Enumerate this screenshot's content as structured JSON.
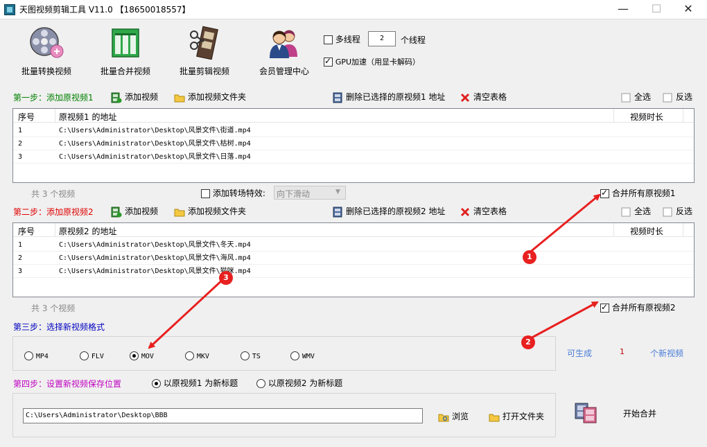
{
  "window": {
    "title": "天图视频剪辑工具 V11.0  【18650018557】",
    "minimize_glyph": "—",
    "maximize_glyph": "☐",
    "close_glyph": "✕"
  },
  "toolbar": {
    "buttons": [
      {
        "label": "批量转换视频",
        "icon": "film-reel-icon"
      },
      {
        "label": "批量合并视频",
        "icon": "merge-grid-icon"
      },
      {
        "label": "批量剪辑视频",
        "icon": "film-scissors-icon"
      },
      {
        "label": "会员管理中心",
        "icon": "members-icon"
      }
    ],
    "multithread_label": "多线程",
    "thread_count": "2",
    "thread_unit": "个线程",
    "gpu_label": "GPU加速（用显卡解码）"
  },
  "step1": {
    "title": "第一步：添加原视频1",
    "add_video": "添加视频",
    "add_folder": "添加视频文件夹",
    "delete_selected": "删除已选择的原视频1 地址",
    "clear_table": "清空表格",
    "select_all": "全选",
    "invert": "反选",
    "columns": {
      "index": "序号",
      "path": "原视频1 的地址",
      "duration": "视频时长"
    },
    "rows": [
      {
        "index": "1",
        "path": "C:\\Users\\Administrator\\Desktop\\风景文件\\街道.mp4"
      },
      {
        "index": "2",
        "path": "C:\\Users\\Administrator\\Desktop\\风景文件\\枯树.mp4"
      },
      {
        "index": "3",
        "path": "C:\\Users\\Administrator\\Desktop\\风景文件\\日落.mp4"
      }
    ],
    "count_text": "共 3 个视频",
    "transition_label": "添加转场特效:",
    "transition_value": "向下滑动",
    "merge_label": "合并所有原视频1"
  },
  "step2": {
    "title": "第二步：添加原视频2",
    "add_video": "添加视频",
    "add_folder": "添加视频文件夹",
    "delete_selected": "删除已选择的原视频2 地址",
    "clear_table": "清空表格",
    "select_all": "全选",
    "invert": "反选",
    "columns": {
      "index": "序号",
      "path": "原视频2 的地址",
      "duration": "视频时长"
    },
    "rows": [
      {
        "index": "1",
        "path": "C:\\Users\\Administrator\\Desktop\\风景文件\\冬天.mp4"
      },
      {
        "index": "2",
        "path": "C:\\Users\\Administrator\\Desktop\\风景文件\\海风.mp4"
      },
      {
        "index": "3",
        "path": "C:\\Users\\Administrator\\Desktop\\风景文件\\猫咪.mp4"
      }
    ],
    "count_text": "共 3 个视频",
    "merge_label": "合并所有原视频2"
  },
  "step3": {
    "title": "第三步：选择新视频格式",
    "formats": [
      "MP4",
      "FLV",
      "MOV",
      "MKV",
      "TS",
      "WMV"
    ],
    "selected_format": "MOV",
    "can_generate_label": "可生成",
    "generate_count": "1",
    "new_video_label": "个新视频"
  },
  "step4": {
    "title": "第四步：设置新视频保存位置",
    "option1": "以原视频1 为新标题",
    "option2": "以原视频2 为新标题",
    "save_path": "C:\\Users\\Administrator\\Desktop\\BBB",
    "browse": "浏览",
    "open_folder": "打开文件夹",
    "start_merge": "开始合并"
  },
  "annotations": [
    "1",
    "2",
    "3"
  ],
  "colors": {
    "step1": "#008000",
    "step2": "#e00000",
    "step3": "#0000c0",
    "step4": "#c000c0",
    "annotation_red": "#e82020",
    "accent_blue": "#4a7cd6"
  }
}
